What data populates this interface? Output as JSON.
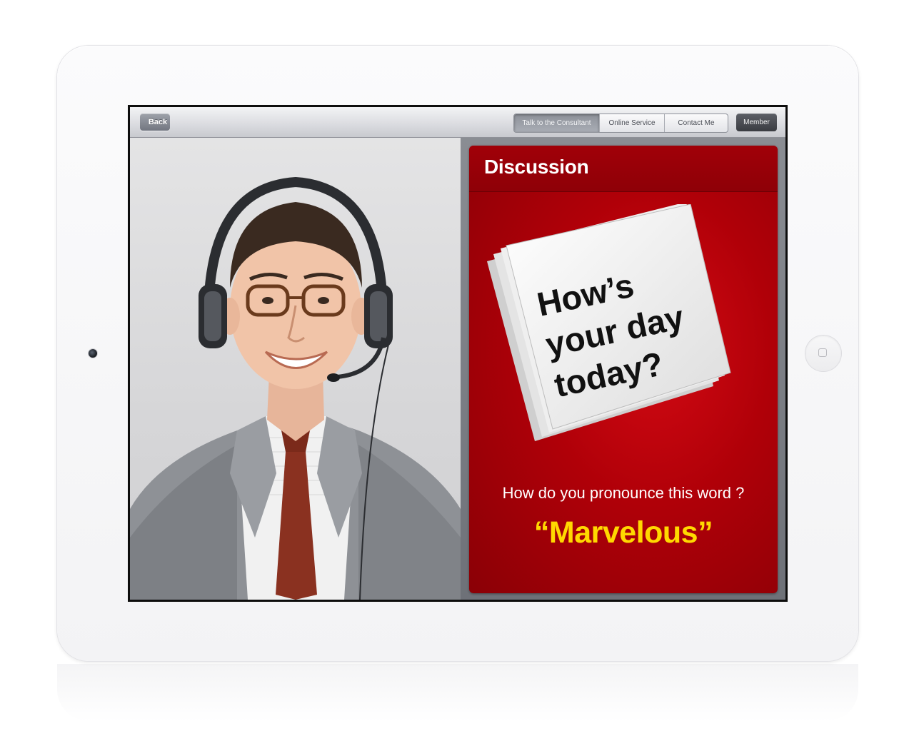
{
  "toolbar": {
    "back_label": "Back",
    "tabs": [
      {
        "label": "Talk to the Consultant",
        "active": true
      },
      {
        "label": "Online Service",
        "active": false
      },
      {
        "label": "Contact Me",
        "active": false
      }
    ],
    "member_label": "Member"
  },
  "discussion": {
    "title": "Discussion",
    "headline_line1": "How’s",
    "headline_line2": "your day",
    "headline_line3": "today?",
    "question": "How do you pronounce this word ?",
    "word": "“Marvelous”"
  },
  "colors": {
    "card_red": "#b00008",
    "header_red": "#8e0007",
    "word_yellow": "#ffd800"
  },
  "icons": {
    "camera": "camera-icon",
    "home": "home-button-icon",
    "back": "back-arrow-icon"
  }
}
